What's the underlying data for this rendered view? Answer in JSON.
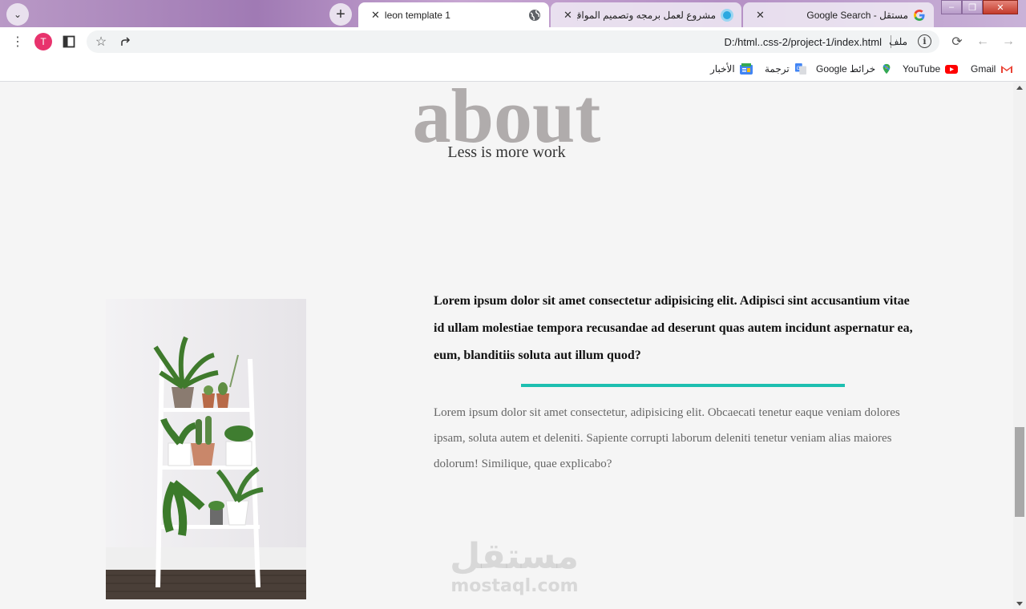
{
  "browser": {
    "tabs": [
      {
        "title": "leon template 1",
        "active": true
      },
      {
        "title": "مشروع لعمل برمجه وتصميم المواقع | مستقل",
        "active": false
      },
      {
        "title": "مستقل - Google Search",
        "active": false
      }
    ],
    "address": {
      "url": "D:/html..css-2/project-1/index.html",
      "scheme_label": "ملف"
    },
    "avatar_initial": "T",
    "bookmarks": [
      {
        "label": "Gmail",
        "icon": "gmail-icon"
      },
      {
        "label": "YouTube",
        "icon": "youtube-icon"
      },
      {
        "label": "خرائط Google",
        "icon": "maps-icon"
      },
      {
        "label": "ترجمة",
        "icon": "translate-icon"
      },
      {
        "label": "الأخبار",
        "icon": "news-icon"
      }
    ]
  },
  "page": {
    "section_title": "about",
    "section_subtitle": "Less is more work",
    "lead_text": "Lorem ipsum dolor sit amet consectetur adipisicing elit. Adipisci sint accusantium vitae id ullam molestiae tempora recusandae ad deserunt quas autem incidunt aspernatur ea, eum, blanditiis soluta aut illum quod?",
    "body_text": "Lorem ipsum dolor sit amet consectetur, adipisicing elit. Obcaecati tenetur eaque veniam dolores ipsam, soluta autem et deleniti. Sapiente corrupti laborum deleniti tenetur veniam alias maiores dolorum! Similique, quae explicabo?",
    "accent_color": "#1dbfb0"
  },
  "watermark": {
    "arabic": "مستقل",
    "latin": "mostaql.com"
  }
}
